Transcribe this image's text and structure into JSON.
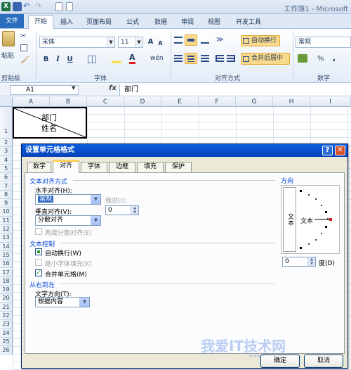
{
  "window": {
    "title": "工作簿1 - Microsoft"
  },
  "ribbon": {
    "file_tab": "文件",
    "tabs": [
      "开始",
      "插入",
      "页面布局",
      "公式",
      "数据",
      "审阅",
      "视图",
      "开发工具"
    ],
    "active_tab": "开始",
    "clipboard": {
      "paste_label": "粘贴",
      "group_label": "剪贴板"
    },
    "font": {
      "name": "宋体",
      "size": "11",
      "group_label": "字体",
      "bold": "B",
      "italic": "I",
      "underline": "U",
      "grow": "A",
      "shrink": "A",
      "phonetic": "wén"
    },
    "alignment": {
      "wrap_label": "自动换行",
      "merge_label": "合并后居中",
      "group_label": "对齐方式"
    },
    "number": {
      "format": "常规",
      "group_label": "数字",
      "percent": "%",
      "comma": ","
    }
  },
  "formula_bar": {
    "name_box": "A1",
    "fx": "fx",
    "value": "部门"
  },
  "sheet": {
    "columns": [
      "A",
      "B",
      "C",
      "D",
      "E",
      "F",
      "G",
      "H",
      "I"
    ],
    "rows": [
      "1",
      "2",
      "3",
      "4",
      "5",
      "6",
      "7",
      "8",
      "9",
      "10",
      "11",
      "12",
      "13",
      "14",
      "15",
      "16",
      "17",
      "18",
      "19",
      "20",
      "21",
      "22",
      "23",
      "24",
      "25",
      "26"
    ],
    "cell_a1_line1": "部门",
    "cell_a1_line2": "姓名"
  },
  "dialog": {
    "title": "设置单元格格式",
    "help": "?",
    "close": "✕",
    "tabs": [
      "数字",
      "对齐",
      "字体",
      "边框",
      "填充",
      "保护"
    ],
    "active_tab": "对齐",
    "text_alignment_title": "文本对齐方式",
    "horizontal_label": "水平对齐(H):",
    "horizontal_value": "常规",
    "indent_label": "缩进(I):",
    "indent_value": "0",
    "vertical_label": "垂直对齐(V):",
    "vertical_value": "分散对齐",
    "justify_distributed": "两端分散对齐(E)",
    "text_control_title": "文本控制",
    "wrap_text": "自动换行(W)",
    "shrink_to_fit": "缩小字体填充(K)",
    "merge_cells": "合并单元格(M)",
    "wrap_checked": "indeterminate",
    "shrink_checked": false,
    "merge_checked": true,
    "rtl_title": "从右到左",
    "text_direction_label": "文字方向(T):",
    "text_direction_value": "根据内容",
    "orientation_title": "方向",
    "orientation_vertical_text": "文本",
    "orientation_text": "文本",
    "degree_value": "0",
    "degree_label": "度(D)",
    "ok": "确定",
    "cancel": "取消"
  },
  "watermark": {
    "text": "我爱IT技术网",
    "url": "www.52itjs.com"
  }
}
